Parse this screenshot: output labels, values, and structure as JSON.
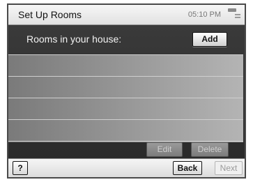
{
  "header": {
    "title": "Set Up Rooms",
    "time": "05:10 PM",
    "menu_icon": "menu-icon"
  },
  "rooms_panel": {
    "label": "Rooms in your house:",
    "add_label": "Add",
    "rooms": [],
    "edit_label": "Edit",
    "delete_label": "Delete"
  },
  "footer": {
    "help_label": "?",
    "back_label": "Back",
    "next_label": "Next"
  },
  "colors": {
    "panel_bg": "#2f2f2f",
    "list_bg": "#9a9a9a",
    "disabled_text": "#cfcfcf"
  }
}
